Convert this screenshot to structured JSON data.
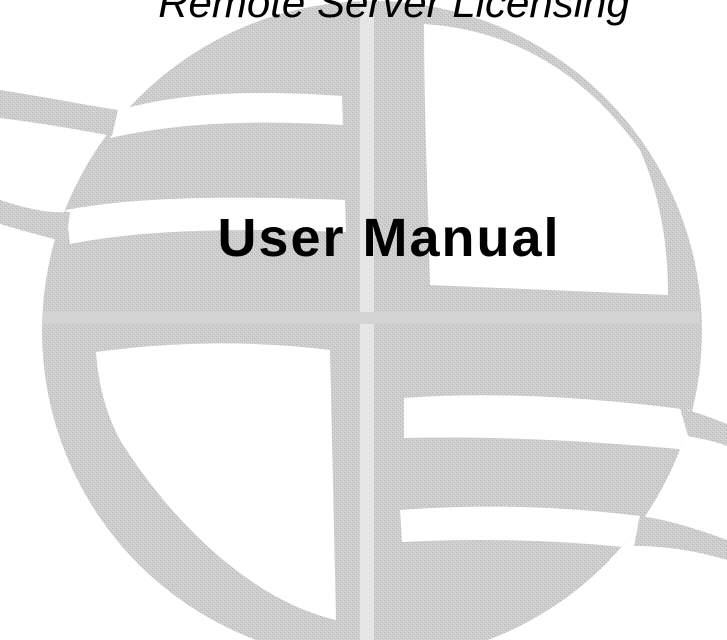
{
  "cover": {
    "subtitle": "Remote Server Licensing",
    "title": "User Manual"
  },
  "emblem": {
    "icon": "globe-watermark-icon",
    "fill_color": "#c9c9c9",
    "light_color": "#ffffff"
  }
}
